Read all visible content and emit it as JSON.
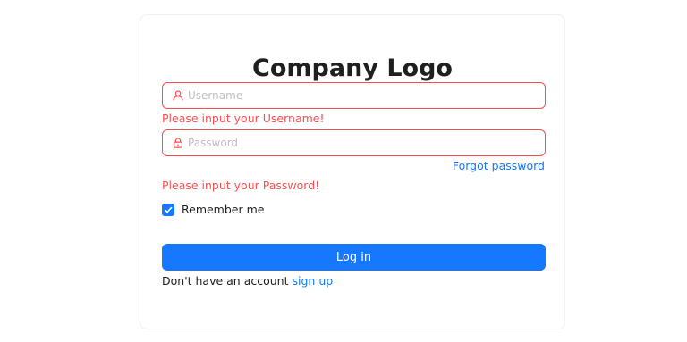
{
  "logo": {
    "text": "Company Logo"
  },
  "username": {
    "placeholder": "Username",
    "value": "",
    "error": "Please input your Username!",
    "icon": "user-icon"
  },
  "password": {
    "placeholder": "Password",
    "value": "",
    "error": "Please input your Password!",
    "icon": "lock-icon"
  },
  "forgot": {
    "label": "Forgot password"
  },
  "remember": {
    "label": "Remember me",
    "checked": true
  },
  "login": {
    "label": "Log in"
  },
  "signup": {
    "prompt": "Don't have an account",
    "link": "sign up"
  },
  "colors": {
    "primary": "#1677ff",
    "error": "#ff4d4f",
    "text": "#1f1f1f",
    "placeholder": "#bfbfbf"
  }
}
